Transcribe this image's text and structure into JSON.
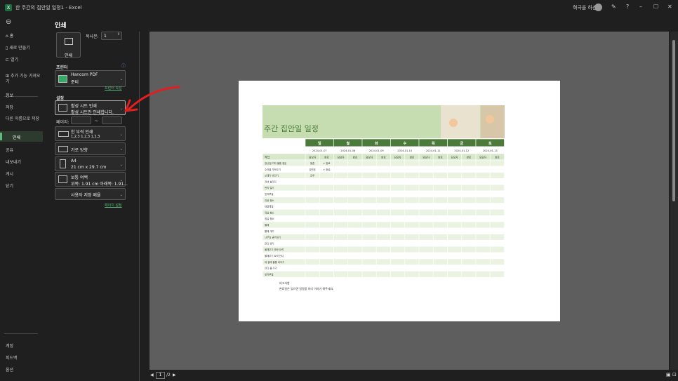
{
  "titlebar": {
    "app_title": "한 주간의 집안일 일정1 - Excel",
    "user": "혁극을 하신",
    "min": "–",
    "max": "☐",
    "close": "✕"
  },
  "side": {
    "back": "⊖",
    "items": [
      {
        "label": "홈",
        "icon": "⌂"
      },
      {
        "label": "새로 만들기",
        "icon": "▯"
      },
      {
        "label": "열기",
        "icon": "⊏"
      },
      {
        "label": "추가 기능 가져오기",
        "icon": "⊞"
      }
    ],
    "items2": [
      "정보",
      "저장",
      "다른 이름으로 저장",
      "인쇄",
      "공유",
      "내보내기",
      "게시",
      "닫기"
    ],
    "bottom": [
      "계정",
      "피드백",
      "옵션"
    ]
  },
  "print": {
    "title": "인쇄",
    "print_label": "인쇄",
    "copies_label": "복사본:",
    "copies_value": "1",
    "printer_heading": "프린터",
    "printer_name": "Hancom PDF",
    "printer_status": "준비",
    "printer_props": "프린터 속성",
    "settings_heading": "설정",
    "dd1_title": "활성 시트 인쇄",
    "dd1_sub": "활성 시트만 인쇄합니다.",
    "pages_label": "페이지:",
    "to_label": "~",
    "dd2_title": "한 부씩 인쇄",
    "dd2_sub": "1,2,3    1,2,3    1,2,3",
    "dd3_title": "가로 방향",
    "dd4_title": "A4",
    "dd4_sub": "21 cm x 29.7 cm",
    "dd5_title": "보통 여백",
    "dd5_sub": "위쪽: 1.91 cm 아래쪽: 1.91...",
    "dd6_title": "사용자 지정 배율",
    "page_setup": "페이지 설정"
  },
  "sheet": {
    "title": "주간 집안일 일정",
    "days": [
      "일",
      "월",
      "화",
      "수",
      "목",
      "금",
      "토"
    ],
    "dates": [
      "2024-01-07",
      "2024-01-08",
      "2024-01-09",
      "2024-01-10",
      "2024-01-11",
      "2024-01-12",
      "2024-01-13"
    ],
    "sub_assignee": "담당자",
    "sub_done": "완료",
    "task_header": "작업",
    "tasks": [
      "장난감/기타 물품 정돈",
      "수건을 가져오기",
      "쓰레기 버리기",
      "저녁 설거지",
      "먼지 털기",
      "빗자루질",
      "진공 청소",
      "대걸레질",
      "욕실 청소",
      "침실 청소",
      "빨래",
      "빨래 개기",
      "나무잎 긁어내기",
      "잔디 깎기",
      "물채우기 안한 트럭",
      "물채우기 트럭 잔디",
      "대 걸레 물통 비우기",
      "잔디 물 주기",
      "빗자루질"
    ],
    "row1": {
      "a": "용준",
      "d": "✔ 완료"
    },
    "row2": {
      "a": "강민호",
      "d": "✔ 완료"
    },
    "row3": {
      "a": "건우"
    },
    "notes_label": "비고사항",
    "notes_text": "완료일은 있으면 일정을 미리 이야기 해주세요."
  },
  "bottom": {
    "page_value": "1",
    "page_total": "/2"
  },
  "colors": {
    "accent": "#5fba7d",
    "header_green": "#4c7a3a",
    "light_green": "#d6e8c9",
    "row_alt": "#eaf3e2",
    "arrow": "#e02020"
  }
}
